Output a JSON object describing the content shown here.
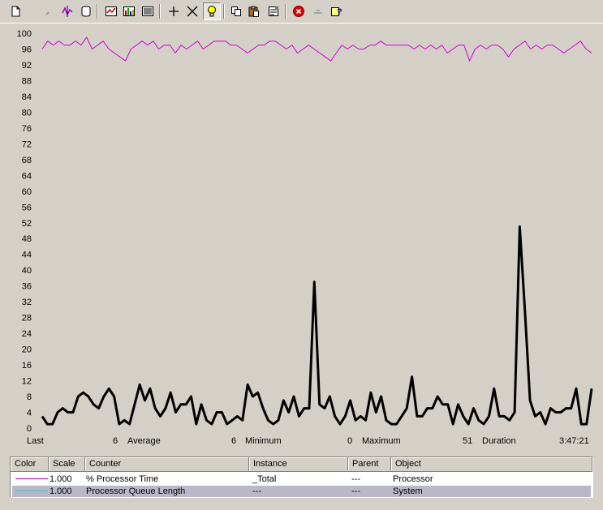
{
  "toolbar": {
    "buttons": [
      {
        "name": "new-counter-set-icon",
        "pressed": false
      },
      {
        "name": "clear-display-icon",
        "pressed": false
      },
      {
        "name": "view-current-activity-icon",
        "pressed": false
      },
      {
        "name": "view-log-data-icon",
        "pressed": false
      },
      {
        "name": "view-graph-icon",
        "pressed": false
      },
      {
        "name": "view-histogram-icon",
        "pressed": false
      },
      {
        "name": "view-report-icon",
        "pressed": false
      },
      {
        "name": "add-counter-icon",
        "pressed": false
      },
      {
        "name": "delete-counter-icon",
        "pressed": false
      },
      {
        "name": "highlight-icon",
        "pressed": true
      },
      {
        "name": "copy-properties-icon",
        "pressed": false
      },
      {
        "name": "paste-counter-list-icon",
        "pressed": false
      },
      {
        "name": "properties-icon",
        "pressed": false
      },
      {
        "name": "freeze-display-icon",
        "pressed": false
      },
      {
        "name": "update-data-icon",
        "pressed": false
      },
      {
        "name": "help-icon",
        "pressed": false
      }
    ]
  },
  "graph": {
    "y_axis": {
      "min": 0,
      "max": 100,
      "ticks": [
        "100",
        "96",
        "92",
        "88",
        "84",
        "80",
        "76",
        "72",
        "68",
        "64",
        "60",
        "56",
        "52",
        "48",
        "44",
        "40",
        "36",
        "32",
        "28",
        "24",
        "20",
        "16",
        "12",
        "8",
        "4",
        "0"
      ]
    }
  },
  "chart_data": {
    "type": "line",
    "ylim": [
      0,
      100
    ],
    "grid": false,
    "series": [
      {
        "name": "% Processor Time",
        "color": "#cc00cc",
        "values": [
          96,
          98,
          97,
          98,
          97,
          97,
          98,
          97,
          99,
          96,
          97,
          98,
          96,
          95,
          94,
          93,
          96,
          97,
          98,
          97,
          98,
          96,
          97,
          97,
          95,
          97,
          96,
          97,
          98,
          96,
          97,
          98,
          98,
          98,
          97,
          97,
          96,
          95,
          96,
          97,
          97,
          98,
          98,
          97,
          96,
          97,
          95,
          96,
          97,
          96,
          95,
          94,
          93,
          95,
          97,
          96,
          97,
          96,
          96,
          97,
          97,
          98,
          97,
          97,
          97,
          97,
          97,
          96,
          97,
          96,
          97,
          96,
          97,
          95,
          96,
          97,
          97,
          93,
          96,
          97,
          96,
          97,
          97,
          96,
          94,
          96,
          97,
          98,
          96,
          97,
          96,
          97,
          97,
          96,
          95,
          96,
          97,
          98,
          96,
          95
        ]
      },
      {
        "name": "Processor Queue Length",
        "color": "#000000",
        "values": [
          3,
          1,
          1,
          4,
          5,
          4,
          4,
          8,
          9,
          8,
          6,
          5,
          8,
          10,
          8,
          1,
          2,
          1,
          6,
          11,
          7,
          10,
          5,
          3,
          5,
          9,
          4,
          6,
          6,
          8,
          1,
          6,
          2,
          1,
          4,
          4,
          1,
          2,
          3,
          2,
          11,
          8,
          9,
          5,
          2,
          1,
          2,
          7,
          4,
          8,
          3,
          5,
          5,
          37,
          6,
          5,
          8,
          3,
          1,
          3,
          7,
          2,
          3,
          2,
          9,
          4,
          8,
          2,
          1,
          1,
          3,
          5,
          13,
          3,
          3,
          5,
          5,
          8,
          6,
          6,
          1,
          6,
          3,
          1,
          5,
          2,
          1,
          3,
          10,
          3,
          3,
          2,
          4,
          51,
          30,
          7,
          3,
          4,
          1,
          5,
          4,
          4,
          5,
          5,
          10,
          1,
          1,
          10
        ]
      }
    ]
  },
  "stats": {
    "last_label": "Last",
    "last_value": "6",
    "average_label": "Average",
    "average_value": "6",
    "minimum_label": "Minimum",
    "minimum_value": "0",
    "maximum_label": "Maximum",
    "maximum_value": "51",
    "duration_label": "Duration",
    "duration_value": "3:47:21"
  },
  "legend": {
    "headers": {
      "color": "Color",
      "scale": "Scale",
      "counter": "Counter",
      "instance": "Instance",
      "parent": "Parent",
      "object": "Object"
    },
    "rows": [
      {
        "swatch": "#cc00cc",
        "scale": "1.000",
        "counter": "% Processor Time",
        "instance": "_Total",
        "parent": "---",
        "object": "Processor",
        "selected": false
      },
      {
        "swatch": "#33cccc",
        "scale": "1.000",
        "counter": "Processor Queue Length",
        "instance": "---",
        "parent": "---",
        "object": "System",
        "selected": true
      }
    ]
  }
}
